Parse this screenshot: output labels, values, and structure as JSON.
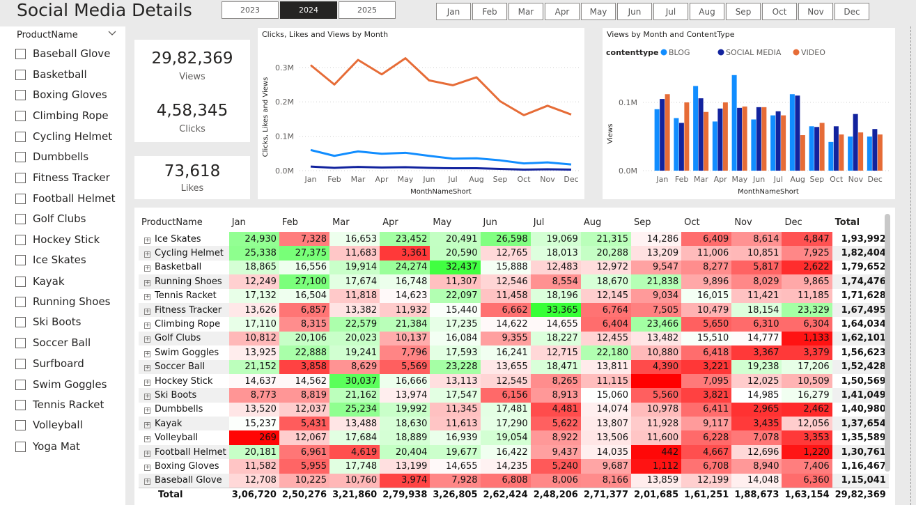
{
  "page_title": "Social Media Details",
  "years": [
    {
      "label": "2023",
      "selected": false
    },
    {
      "label": "2024",
      "selected": true
    },
    {
      "label": "2025",
      "selected": false
    }
  ],
  "months": [
    "Jan",
    "Feb",
    "Mar",
    "Apr",
    "May",
    "Jun",
    "Jul",
    "Aug",
    "Sep",
    "Oct",
    "Nov",
    "Dec"
  ],
  "slicer": {
    "header": "ProductName",
    "items": [
      "Baseball Glove",
      "Basketball",
      "Boxing Gloves",
      "Climbing Rope",
      "Cycling Helmet",
      "Dumbbells",
      "Fitness Tracker",
      "Football Helmet",
      "Golf Clubs",
      "Hockey Stick",
      "Ice Skates",
      "Kayak",
      "Running Shoes",
      "Ski Boots",
      "Soccer Ball",
      "Surfboard",
      "Swim Goggles",
      "Tennis Racket",
      "Volleyball",
      "Yoga Mat"
    ]
  },
  "cards": {
    "views": {
      "value": "29,82,369",
      "label": "Views"
    },
    "clicks": {
      "value": "4,58,345",
      "label": "Clicks"
    },
    "likes": {
      "value": "73,618",
      "label": "Likes"
    }
  },
  "chart_data": [
    {
      "type": "line",
      "title": "Clicks, Likes and Views by Month",
      "xlabel": "MonthNameShort",
      "ylabel": "Clicks, Likes and Views",
      "categories": [
        "Jan",
        "Feb",
        "Mar",
        "Apr",
        "May",
        "Jun",
        "Jul",
        "Aug",
        "Sep",
        "Oct",
        "Nov",
        "Dec"
      ],
      "ylim": [
        0,
        330000
      ],
      "yticks": [
        "0.0M",
        "0.1M",
        "0.2M",
        "0.3M"
      ],
      "grid": true,
      "series": [
        {
          "color": "#e66c37",
          "values": [
            306720,
            250276,
            321860,
            279938,
            326805,
            262424,
            248206,
            271377,
            201685,
            161251,
            188673,
            163154
          ]
        },
        {
          "color": "#118dff",
          "values": [
            60000,
            43000,
            56000,
            49000,
            52000,
            43000,
            35000,
            36000,
            30000,
            21000,
            24000,
            18000
          ]
        },
        {
          "color": "#12239e",
          "values": [
            12000,
            8000,
            11000,
            9000,
            10000,
            8000,
            7000,
            7000,
            5000,
            3000,
            4000,
            3000
          ]
        }
      ]
    },
    {
      "type": "bar",
      "title": "Views by Month and ContentType",
      "xlabel": "MonthNameShort",
      "ylabel": "Views",
      "legend_title": "contenttype",
      "categories": [
        "Jan",
        "Feb",
        "Mar",
        "Apr",
        "May",
        "Jun",
        "Jul",
        "Aug",
        "Sep",
        "Oct",
        "Nov",
        "Dec"
      ],
      "ylim": [
        0,
        160000
      ],
      "yticks": [
        "0.0M",
        "0.1M"
      ],
      "grid": true,
      "series": [
        {
          "name": "BLOG",
          "color": "#118dff",
          "values": [
            90000,
            77000,
            124000,
            72000,
            140000,
            75000,
            81000,
            112000,
            65000,
            42000,
            50000,
            50000
          ]
        },
        {
          "name": "SOCIAL MEDIA",
          "color": "#12239e",
          "values": [
            105000,
            70000,
            106000,
            91000,
            92000,
            93000,
            87000,
            110000,
            64000,
            65000,
            83000,
            61000
          ]
        },
        {
          "name": "VIDEO",
          "color": "#e66c37",
          "values": [
            112000,
            100000,
            86000,
            100000,
            94000,
            93000,
            81000,
            52000,
            70000,
            53000,
            56000,
            53000
          ]
        }
      ]
    }
  ],
  "table": {
    "headers": [
      "ProductName",
      "Jan",
      "Feb",
      "Mar",
      "Apr",
      "May",
      "Jun",
      "Jul",
      "Aug",
      "Sep",
      "Oct",
      "Nov",
      "Dec",
      "Total"
    ],
    "rows": [
      {
        "name": "Ice Skates",
        "cells": [
          "24,930",
          "7,328",
          "16,653",
          "23,452",
          "20,491",
          "26,598",
          "19,069",
          "21,315",
          "14,286",
          "6,409",
          "8,614",
          "4,847"
        ],
        "total": "1,93,992"
      },
      {
        "name": "Cycling Helmet",
        "cells": [
          "25,338",
          "27,375",
          "11,683",
          "3,361",
          "20,590",
          "12,765",
          "18,013",
          "20,288",
          "13,209",
          "11,006",
          "10,851",
          "7,925"
        ],
        "total": "1,82,404"
      },
      {
        "name": "Basketball",
        "cells": [
          "18,865",
          "16,556",
          "19,914",
          "24,274",
          "32,437",
          "15,888",
          "12,483",
          "12,972",
          "9,547",
          "8,277",
          "5,817",
          "2,622"
        ],
        "total": "1,79,652"
      },
      {
        "name": "Running Shoes",
        "cells": [
          "12,249",
          "27,100",
          "17,674",
          "16,748",
          "11,307",
          "12,546",
          "8,554",
          "18,670",
          "21,838",
          "9,896",
          "8,029",
          "9,865"
        ],
        "total": "1,74,476"
      },
      {
        "name": "Tennis Racket",
        "cells": [
          "17,132",
          "16,504",
          "11,818",
          "14,623",
          "22,097",
          "11,458",
          "18,196",
          "12,145",
          "9,034",
          "16,015",
          "11,421",
          "11,185"
        ],
        "total": "1,71,628"
      },
      {
        "name": "Fitness Tracker",
        "cells": [
          "13,626",
          "6,857",
          "13,382",
          "11,932",
          "15,440",
          "6,662",
          "33,365",
          "6,764",
          "7,505",
          "10,479",
          "18,154",
          "23,329"
        ],
        "total": "1,67,495"
      },
      {
        "name": "Climbing Rope",
        "cells": [
          "17,110",
          "8,315",
          "22,579",
          "21,384",
          "17,235",
          "14,622",
          "14,655",
          "6,404",
          "23,466",
          "5,650",
          "6,310",
          "6,304"
        ],
        "total": "1,64,034"
      },
      {
        "name": "Golf Clubs",
        "cells": [
          "10,812",
          "20,106",
          "20,023",
          "10,137",
          "16,084",
          "9,355",
          "18,227",
          "12,455",
          "13,482",
          "15,510",
          "14,777",
          "1,133"
        ],
        "total": "1,62,101"
      },
      {
        "name": "Swim Goggles",
        "cells": [
          "13,925",
          "22,888",
          "19,241",
          "7,796",
          "17,593",
          "16,241",
          "12,715",
          "22,180",
          "10,880",
          "6,418",
          "3,367",
          "3,379"
        ],
        "total": "1,56,623"
      },
      {
        "name": "Soccer Ball",
        "cells": [
          "21,152",
          "3,858",
          "8,629",
          "5,569",
          "23,228",
          "13,655",
          "18,471",
          "13,811",
          "4,390",
          "3,221",
          "19,238",
          "17,206"
        ],
        "total": "1,52,428"
      },
      {
        "name": "Hockey Stick",
        "cells": [
          "14,637",
          "14,562",
          "30,037",
          "16,666",
          "13,113",
          "12,545",
          "8,265",
          "11,115",
          "",
          "7,095",
          "12,025",
          "10,509"
        ],
        "total": "1,50,569"
      },
      {
        "name": "Ski Boots",
        "cells": [
          "8,773",
          "8,819",
          "21,162",
          "13,974",
          "17,547",
          "6,156",
          "8,913",
          "15,060",
          "5,560",
          "3,821",
          "14,985",
          "16,279"
        ],
        "total": "1,41,049"
      },
      {
        "name": "Dumbbells",
        "cells": [
          "13,520",
          "12,037",
          "25,234",
          "19,992",
          "11,345",
          "17,481",
          "4,481",
          "14,074",
          "10,978",
          "6,411",
          "2,965",
          "2,462"
        ],
        "total": "1,40,980"
      },
      {
        "name": "Kayak",
        "cells": [
          "15,237",
          "5,431",
          "13,488",
          "18,630",
          "11,613",
          "17,290",
          "5,622",
          "13,807",
          "11,928",
          "9,117",
          "3,435",
          "12,056"
        ],
        "total": "1,37,654"
      },
      {
        "name": "Volleyball",
        "cells": [
          "269",
          "12,067",
          "17,684",
          "18,889",
          "16,939",
          "19,054",
          "8,922",
          "13,506",
          "11,600",
          "6,228",
          "7,078",
          "3,353"
        ],
        "total": "1,35,589"
      },
      {
        "name": "Football Helmet",
        "cells": [
          "20,181",
          "6,961",
          "4,619",
          "20,404",
          "19,677",
          "16,422",
          "9,437",
          "14,035",
          "442",
          "4,667",
          "12,696",
          "1,220"
        ],
        "total": "1,30,761"
      },
      {
        "name": "Boxing Gloves",
        "cells": [
          "11,582",
          "5,955",
          "17,748",
          "13,199",
          "14,655",
          "14,235",
          "5,240",
          "9,687",
          "1,112",
          "6,708",
          "8,940",
          "7,406"
        ],
        "total": "1,16,467"
      },
      {
        "name": "Baseball Glove",
        "cells": [
          "12,708",
          "10,225",
          "10,760",
          "3,974",
          "7,928",
          "6,808",
          "8,006",
          "8,166",
          "13,859",
          "12,199",
          "14,048",
          "6,360"
        ],
        "total": "1,15,041"
      }
    ],
    "total_row": {
      "name": "Total",
      "cells": [
        "3,06,720",
        "2,50,276",
        "3,21,860",
        "2,79,938",
        "3,26,805",
        "2,62,424",
        "2,48,206",
        "2,71,377",
        "2,01,685",
        "1,61,251",
        "1,88,673",
        "1,63,154"
      ],
      "total": "29,82,369"
    }
  }
}
